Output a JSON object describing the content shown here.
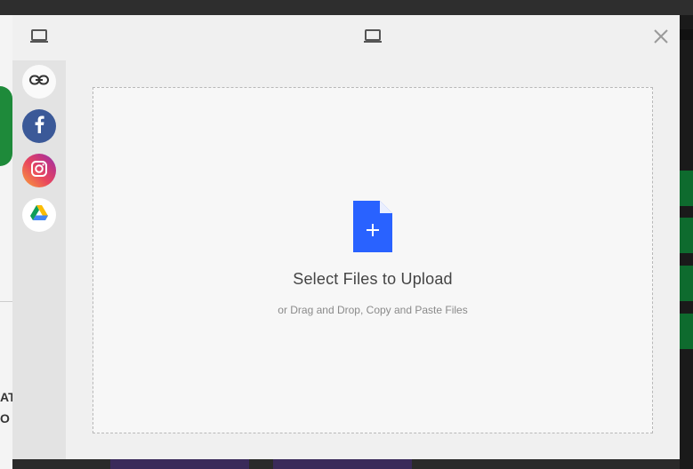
{
  "header": {
    "left_icon": "laptop-icon",
    "center_icon": "laptop-icon",
    "close_icon": "close-icon"
  },
  "sidebar": {
    "items": [
      {
        "id": "link",
        "icon": "link-icon",
        "color": "#fafafa"
      },
      {
        "id": "facebook",
        "icon": "facebook-icon",
        "color": "#3b5998"
      },
      {
        "id": "instagram",
        "icon": "instagram-icon",
        "color": "#e1306c"
      },
      {
        "id": "google-drive",
        "icon": "google-drive-icon",
        "color": "#ffffff"
      }
    ]
  },
  "dropzone": {
    "icon": "file-plus-icon",
    "icon_color": "#2962ff",
    "title": "Select Files to Upload",
    "subtitle": "or Drag and Drop, Copy and Paste Files"
  },
  "background": {
    "left_fragment_lines": [
      "AT",
      "O"
    ]
  }
}
